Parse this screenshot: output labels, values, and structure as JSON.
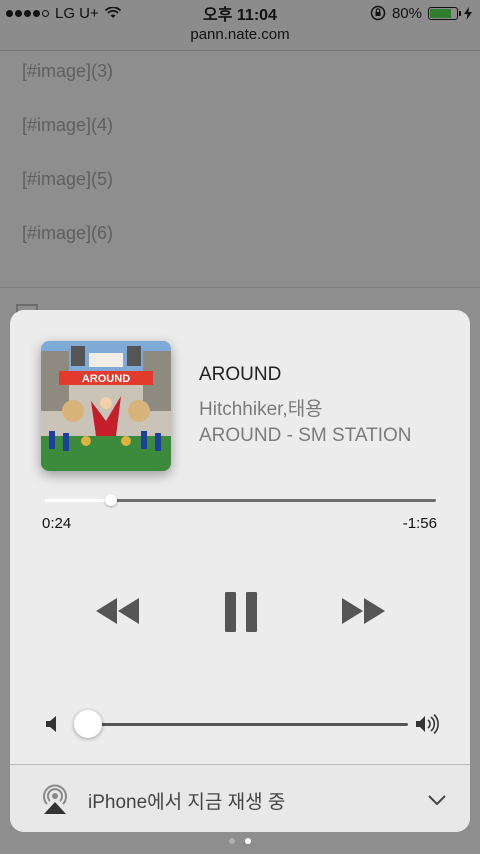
{
  "status_bar": {
    "carrier": "LG U+",
    "time": "오후 11:04",
    "battery": "80%",
    "battery_level": 0.8
  },
  "browser": {
    "url": "pann.nate.com"
  },
  "background_page": {
    "image_placeholders": [
      "[#image](3)",
      "[#image](4)",
      "[#image](5)",
      "[#image](6)"
    ]
  },
  "now_playing": {
    "title": "AROUND",
    "artist": "Hitchhiker,태용",
    "album": "AROUND - SM STATION",
    "elapsed": "0:24",
    "remaining": "-1:56",
    "progress": 0.17,
    "volume": 0.0,
    "album_art_text": "AROUND"
  },
  "output": {
    "label": "iPhone에서 지금 재생 중"
  },
  "page_indicator": {
    "count": 2,
    "current": 2
  },
  "colors": {
    "card_bg": "#ececec",
    "dim_bg": "#8e8e8e",
    "battery_fill": "#2f7d2f"
  }
}
